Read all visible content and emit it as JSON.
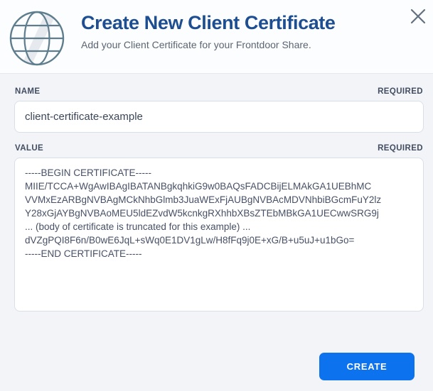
{
  "modal": {
    "title": "Create New Client Certificate",
    "subtitle": "Add your Client Certificate for your Frontdoor Share."
  },
  "form": {
    "name_field": {
      "label": "NAME",
      "required_badge": "REQUIRED",
      "value": "client-certificate-example"
    },
    "value_field": {
      "label": "VALUE",
      "required_badge": "REQUIRED",
      "value": "-----BEGIN CERTIFICATE-----\nMIIE/TCCA+WgAwIBAgIBATANBgkqhkiG9w0BAQsFADCBijELMAkGA1UEBhMC\nVVMxEzARBgNVBAgMCkNhbGlmb3JuaWExFjAUBgNVBAcMDVNhbiBGcmFuY2lz\nY28xGjAYBgNVBAoMEU5ldEZvdW5kcnkgRXhhbXBsZTEbMBkGA1UECwwSRG9j\n... (body of certificate is truncated for this example) ...\ndVZgPQI8F6n/B0wE6JqL+sWq0E1DV1gLw/H8fFq9j0E+xG/B+u5uJ+u1bGo=\n-----END CERTIFICATE-----"
    },
    "submit_label": "CREATE"
  },
  "icons": {
    "globe": "globe-icon",
    "close": "close-icon"
  },
  "colors": {
    "title": "#1d4e91",
    "accent": "#0d72ee",
    "body_background": "#f2f4f8",
    "header_background": "#fcfdfe",
    "field_border": "#d9dfe9",
    "label_text": "#434d61",
    "globe_stroke": "#5e7d8d"
  }
}
